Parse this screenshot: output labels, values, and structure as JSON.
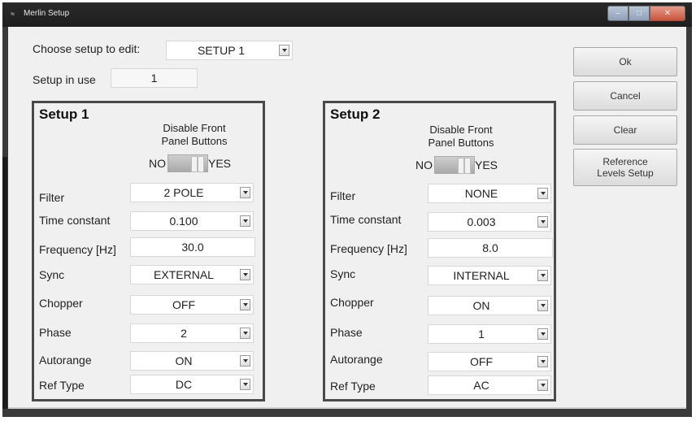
{
  "window": {
    "title": "Merlin Setup",
    "min_glyph": "–",
    "max_glyph": "□",
    "close_glyph": "✕"
  },
  "header": {
    "choose_label": "Choose setup to edit:",
    "choose_value": "SETUP 1",
    "inuse_label": "Setup in use",
    "inuse_value": "1"
  },
  "buttons": {
    "ok": "Ok",
    "cancel": "Cancel",
    "clear": "Clear",
    "reference_line1": "Reference",
    "reference_line2": "Levels Setup"
  },
  "labels": {
    "disable_line1": "Disable Front",
    "disable_line2": "Panel Buttons",
    "no": "NO",
    "yes": "YES",
    "filter": "Filter",
    "time_constant": "Time constant",
    "frequency": "Frequency [Hz]",
    "sync": "Sync",
    "chopper": "Chopper",
    "phase": "Phase",
    "autorange": "Autorange",
    "ref_type": "Ref Type"
  },
  "setup1": {
    "title": "Setup 1",
    "toggle_state": "YES",
    "filter": "2 POLE",
    "time_constant": "0.100",
    "frequency": "30.0",
    "sync": "EXTERNAL",
    "chopper": "OFF",
    "phase": "2",
    "autorange": "ON",
    "ref_type": "DC"
  },
  "setup2": {
    "title": "Setup 2",
    "toggle_state": "YES",
    "filter": "NONE",
    "time_constant": "0.003",
    "frequency": "8.0",
    "sync": "INTERNAL",
    "chopper": "ON",
    "phase": "1",
    "autorange": "OFF",
    "ref_type": "AC"
  },
  "colors": {
    "titlebar": "#1e1e1e",
    "client_bg": "#f0f0f0",
    "panel_border": "#4a4a4a",
    "close_button": "#c9533b"
  }
}
